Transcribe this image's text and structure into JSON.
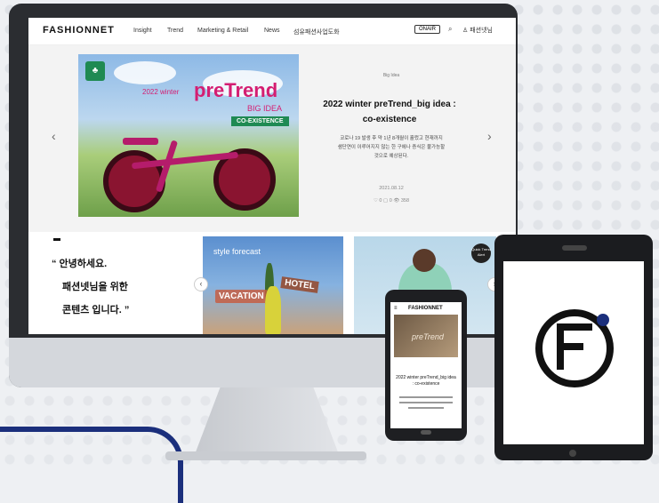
{
  "site": {
    "logo": "FASHIONNET",
    "nav": [
      "Insight",
      "Trend",
      "Marketing & Retail",
      "News",
      "섬유패션사업도화"
    ],
    "onair": "ONAIR",
    "search_icon": "⌕",
    "user_label": "패션넷님"
  },
  "hero": {
    "category": "Big Idea",
    "title_line1": "2022 winter preTrend_big idea :",
    "title_line2": "co-existence",
    "desc_line1": "코로나 19 발생 후 약 1년 8개월이 흘렀고 현재까지",
    "desc_line2": "샘단연이 이루어지지 않는 한 구에나 증식은 불가능할",
    "desc_line3": "것으로 예상된다.",
    "date": "2021.08.12",
    "stats": "♡ 0   ▢ 0   👁 358",
    "image_text": {
      "small": "2022 winter",
      "big": "preTrend",
      "idea": "BIG IDEA",
      "co": "CO-EXISTENCE"
    }
  },
  "greeting": {
    "line1": "“ 안녕하세요.",
    "line2": "패션넷님을 위한",
    "line3": "콘텐츠 입니다. ”"
  },
  "thumbs": {
    "t1_forecast": "style forecast",
    "t1_vacation": "VACATION",
    "t1_hotel": "HOTEL",
    "t2_badge": "Quick Trend Alert"
  },
  "phone": {
    "logo": "FASHIONNET",
    "image_word": "preTrend",
    "title": "2022 winter preTrend_big idea : co-existence"
  },
  "colors": {
    "accent_pink": "#d41e72",
    "accent_green": "#1f8a53",
    "brand_blue": "#1b2f7c"
  }
}
